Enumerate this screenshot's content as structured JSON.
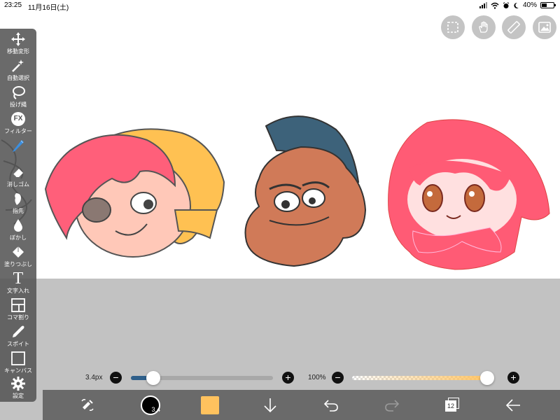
{
  "status_bar": {
    "time": "23:25",
    "date": "11月16日(土)",
    "battery": "40%"
  },
  "toolbar": {
    "items": [
      {
        "label": "移動変形"
      },
      {
        "label": "自動選択"
      },
      {
        "label": "投げ縄"
      },
      {
        "label": "フィルター",
        "icon_text": "FX"
      },
      {
        "label": "ペン"
      },
      {
        "label": "消しゴム"
      },
      {
        "label": "指先"
      },
      {
        "label": "ぼかし"
      },
      {
        "label": "塗りつぶし"
      },
      {
        "label": "文字入れ",
        "icon_text": "T"
      },
      {
        "label": "コマ割り"
      },
      {
        "label": "スポイト"
      },
      {
        "label": "キャンバス"
      },
      {
        "label": "設定"
      }
    ]
  },
  "brush": {
    "size_label": "3.4px",
    "size_fraction": 0.12,
    "preview_text": "3.4"
  },
  "opacity": {
    "label": "100%",
    "fraction": 1.0
  },
  "layers": {
    "count": "12"
  },
  "colors": {
    "current": "#ffc25e",
    "accent": "#2e5f8a"
  }
}
